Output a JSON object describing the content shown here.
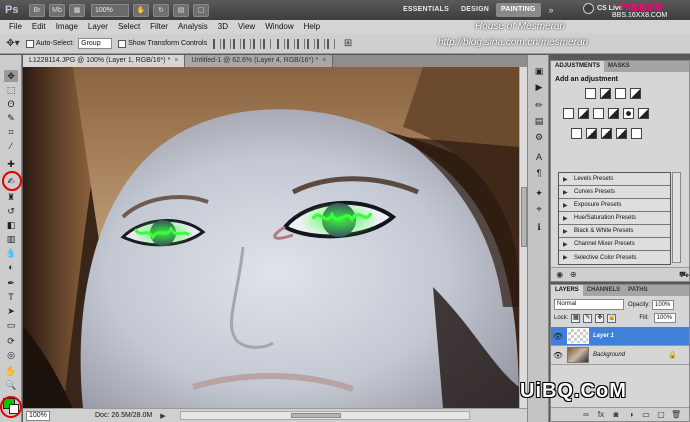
{
  "app": {
    "logo": "Ps",
    "zoom": "100%"
  },
  "workspaces": [
    {
      "label": "ESSENTIALS"
    },
    {
      "label": "DESIGN"
    },
    {
      "label": "PAINTING"
    }
  ],
  "workspace_more": "»",
  "cslive": {
    "label": "CS Live"
  },
  "watermark_top": {
    "text": "PS教程论坛",
    "url": "BBS.16XX8.COM"
  },
  "menu": [
    "File",
    "Edit",
    "Image",
    "Layer",
    "Select",
    "Filter",
    "Analysis",
    "3D",
    "View",
    "Window",
    "Help"
  ],
  "watermarks": {
    "line1": "House of Mesmeran",
    "line2": "http://blog.sina.com.cn/mesmeran",
    "logo": "UiBQ.CoM"
  },
  "options": {
    "auto_select_label": "Auto-Select:",
    "group_value": "Group",
    "transform_label": "Show Transform Controls"
  },
  "doc_tabs": [
    {
      "label": "L1228114.JPG @ 100% (Layer 1, RGB/16*) *",
      "close": "×"
    },
    {
      "label": "Untitled-1 @ 62.6% (Layer 4, RGB/16*) *",
      "close": "×"
    }
  ],
  "status": {
    "zoom": "100%",
    "doc": "Doc: 26.5M/28.0M",
    "arrow": "▶"
  },
  "adjustments": {
    "tabs": [
      "ADJUSTMENTS",
      "MASKS"
    ],
    "title": "Add an adjustment",
    "presets": [
      "Levels Presets",
      "Curves Presets",
      "Exposure Presets",
      "Hue/Saturation Presets",
      "Black & White Presets",
      "Channel Mixer Presets",
      "Selective Color Presets"
    ]
  },
  "layers": {
    "tabs": [
      "LAYERS",
      "CHANNELS",
      "PATHS"
    ],
    "blend_mode": "Normal",
    "opacity_label": "Opacity:",
    "opacity": "100%",
    "lock_label": "Lock:",
    "fill_label": "Fill:",
    "fill": "100%",
    "items": [
      {
        "name": "Layer 1",
        "selected": true
      },
      {
        "name": "Background",
        "selected": false
      }
    ],
    "footer_fx": "fx"
  },
  "colors": {
    "foreground": "#00c800",
    "background": "#ffffff",
    "selection": "#3f81d8",
    "eye_glow": "#3cff3c"
  }
}
